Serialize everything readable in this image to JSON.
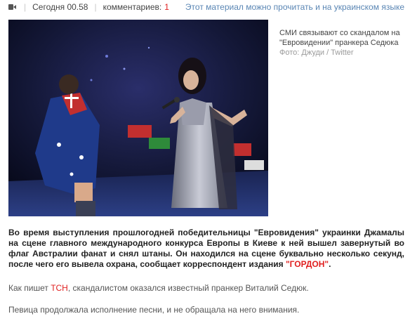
{
  "meta": {
    "video_icon": "video-camera-icon",
    "date": "Сегодня 00.58",
    "comments_label": "комментариев:",
    "comments_count": "1",
    "ukrainian_link": "Этот материал можно прочитать и на украинском языке"
  },
  "photo": {
    "caption": "СМИ связывают со скандалом на \"Евровидении\" пранкера Седюка",
    "credit": "Фото: Джуди / Twitter"
  },
  "article": {
    "p1_before": "Во время выступления прошлогодней победительницы \"Евровидения\" украинки Джамалы на сцене главного международного конкурса Европы в Киеве к ней вышел завернутый во флаг Австралии фанат и снял штаны. Он находился на сцене буквально несколько секунд, после чего его вывела охрана, сообщает корреспондент издания ",
    "p1_highlight": "\"ГОРДОН\"",
    "p1_after": ".",
    "p2_before": "Как пишет ",
    "p2_link": "ТСН",
    "p2_after": ", скандалистом оказался известный пранкер Виталий Седюк.",
    "p3": "Певица продолжала исполнение песни, и не обращала на него внимания."
  },
  "colors": {
    "accent_red": "#e02020",
    "link_blue": "#5a86b4",
    "caption_gray": "#9a9a9a"
  }
}
